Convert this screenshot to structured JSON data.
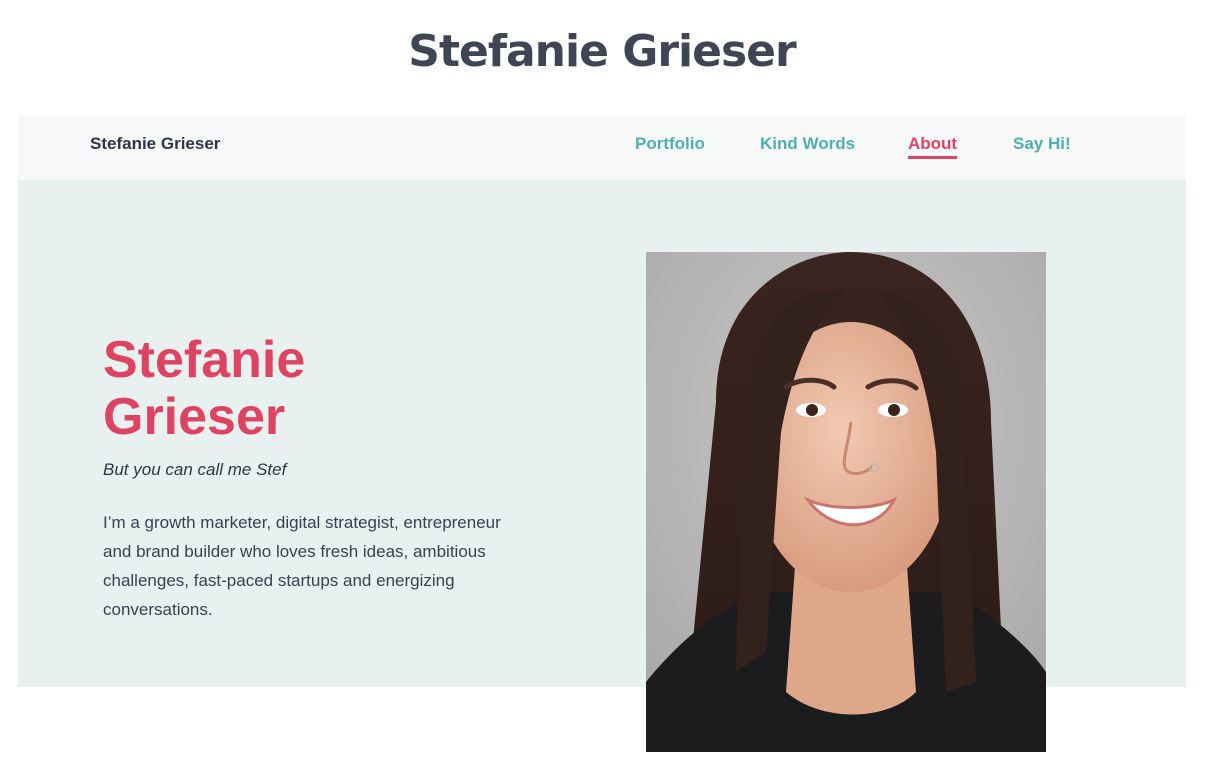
{
  "page_title": "Stefanie Grieser",
  "navbar": {
    "brand": "Stefanie Grieser",
    "links": [
      {
        "label": "Portfolio",
        "active": false
      },
      {
        "label": "Kind Words",
        "active": false
      },
      {
        "label": "About",
        "active": true
      },
      {
        "label": "Say Hi!",
        "active": false
      }
    ]
  },
  "hero": {
    "name_line1": "Stefanie",
    "name_line2": "Grieser",
    "tagline": "But you can call me Stef",
    "bio": "I’m a growth marketer, digital strategist, entrepreneur and brand builder who loves fresh ideas, ambitious challenges, fast-paced startups and energizing conversations."
  },
  "colors": {
    "accent": "#de4461",
    "link": "#4fb0a9",
    "hero_bg": "#e8f1f0",
    "nav_bg": "#f6f8f9",
    "text": "#2f3545"
  }
}
